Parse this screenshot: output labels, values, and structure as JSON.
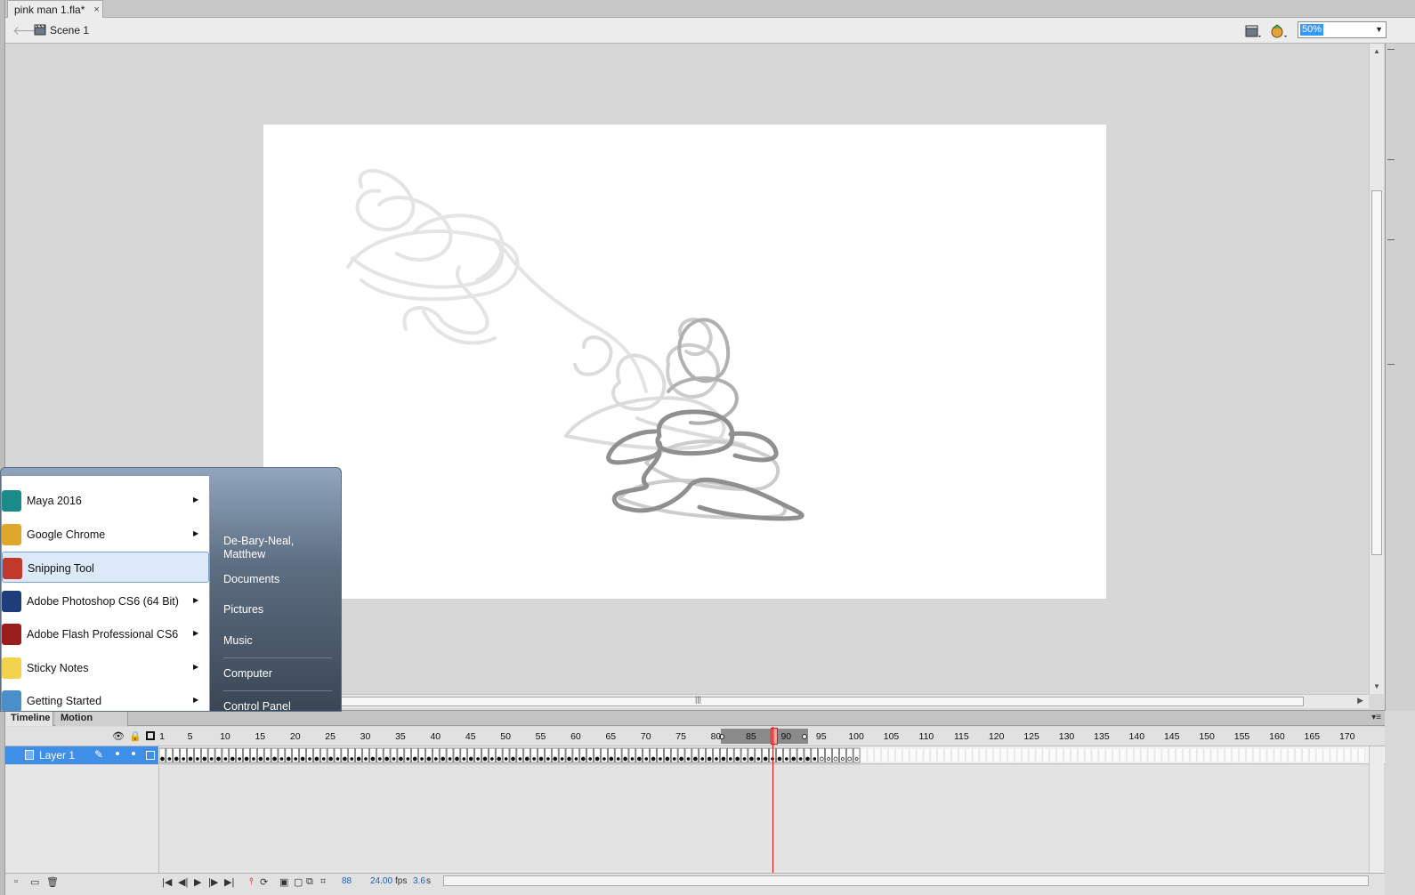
{
  "document_tab": {
    "title": "pink man 1.fla*",
    "close": "×"
  },
  "scene_bar": {
    "scene_label": "Scene 1",
    "zoom": "50%"
  },
  "timeline": {
    "tabs": [
      "Timeline",
      "Motion Editor"
    ],
    "frame_numbers": [
      "1",
      "5",
      "10",
      "15",
      "20",
      "25",
      "30",
      "35",
      "40",
      "45",
      "50",
      "55",
      "60",
      "65",
      "70",
      "75",
      "80",
      "85",
      "90",
      "95",
      "100",
      "105",
      "110",
      "115",
      "120",
      "125",
      "130",
      "135",
      "140",
      "145",
      "150",
      "155",
      "160",
      "165",
      "170"
    ],
    "layer_name": "Layer 1",
    "current_frame": "88",
    "fps": "24.00",
    "fps_unit": "fps",
    "time": "3.6",
    "time_unit": "s",
    "onion_skin_range": [
      82,
      93
    ],
    "last_frame": 100
  },
  "start_menu": {
    "programs": [
      {
        "label": "Maya 2016",
        "icon": "maya-icon",
        "color": "#1a8a8a",
        "arrow": true
      },
      {
        "label": "Google Chrome",
        "icon": "chrome-icon",
        "color": "#e0a82a",
        "arrow": true
      },
      {
        "label": "Snipping Tool",
        "icon": "snipping-tool-icon",
        "color": "#c0392b",
        "arrow": false
      },
      {
        "label": "Adobe Photoshop CS6 (64 Bit)",
        "icon": "photoshop-icon",
        "color": "#1f3d7a",
        "arrow": true
      },
      {
        "label": "Adobe Flash Professional CS6",
        "icon": "flash-icon",
        "color": "#9a1d1d",
        "arrow": true
      },
      {
        "label": "Sticky Notes",
        "icon": "sticky-notes-icon",
        "color": "#f2d34b",
        "arrow": true
      },
      {
        "label": "Getting Started",
        "icon": "getting-started-icon",
        "color": "#4a8fc9",
        "arrow": true
      }
    ],
    "places": [
      "De-Bary-Neal,",
      "Matthew",
      "Documents",
      "Pictures",
      "Music",
      "Computer",
      "Control Panel"
    ]
  },
  "colors": {
    "accent_selection": "#3f8ee8",
    "playhead": "#d11111",
    "zoom_highlight": "#3399ff"
  }
}
